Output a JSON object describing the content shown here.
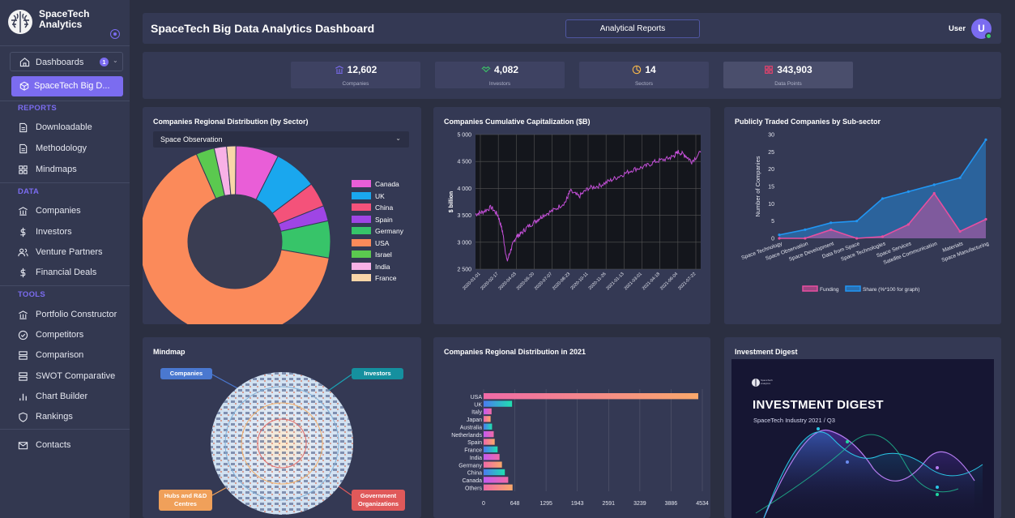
{
  "app": {
    "name": "SpaceTech Analytics"
  },
  "sidebar": {
    "dashboards_label": "Dashboards",
    "dashboards_badge": "1",
    "active_label": "SpaceTech Big D...",
    "reports_section": "REPORTS",
    "reports": [
      {
        "label": "Downloadable",
        "icon": "document-icon"
      },
      {
        "label": "Methodology",
        "icon": "document-icon"
      },
      {
        "label": "Mindmaps",
        "icon": "grid-icon"
      }
    ],
    "data_section": "DATA",
    "data_items": [
      {
        "label": "Companies",
        "icon": "building-icon"
      },
      {
        "label": "Investors",
        "icon": "dollar-icon"
      },
      {
        "label": "Venture Partners",
        "icon": "users-icon"
      },
      {
        "label": "Financial Deals",
        "icon": "dollar-icon"
      }
    ],
    "tools_section": "TOOLS",
    "tools": [
      {
        "label": "Portfolio Constructor",
        "icon": "building-icon"
      },
      {
        "label": "Competitors",
        "icon": "check-circle-icon"
      },
      {
        "label": "Comparison",
        "icon": "server-icon"
      },
      {
        "label": "SWOT Comparative",
        "icon": "server-icon"
      },
      {
        "label": "Chart Builder",
        "icon": "bar-chart-icon"
      },
      {
        "label": "Rankings",
        "icon": "shield-icon"
      }
    ],
    "contacts_label": "Contacts"
  },
  "header": {
    "title": "SpaceTech Big Data Analytics Dashboard",
    "reports_button": "Analytical Reports",
    "user_label": "User",
    "avatar_letter": "U"
  },
  "stats": [
    {
      "value": "12,602",
      "label": "Companies",
      "icon": "building-icon"
    },
    {
      "value": "4,082",
      "label": "Investors",
      "icon": "handshake-icon"
    },
    {
      "value": "14",
      "label": "Sectors",
      "icon": "pie-icon"
    },
    {
      "value": "343,903",
      "label": "Data Points",
      "icon": "grid-icon"
    }
  ],
  "panels": {
    "p1": {
      "title": "Companies Regional Distribution (by Sector)",
      "select_value": "Space Observation"
    },
    "p2": {
      "title": "Companies Cumulative Capitalization ($B)"
    },
    "p3": {
      "title": "Publicly Traded Companies by Sub-sector"
    },
    "p4": {
      "title": "Mindmap",
      "tags": [
        "Companies",
        "Investors",
        "Hubs and R&D Centres",
        "Government Organizations"
      ]
    },
    "p5": {
      "title": "Companies Regional Distribution in 2021"
    },
    "p6": {
      "title": "Investment Digest",
      "digest_title": "INVESTMENT DIGEST",
      "digest_sub": "SpaceTech Industry 2021 / Q3",
      "digest_logo": "SpaceTech Analytics"
    }
  },
  "colors": {
    "accent": "#7b6cf0",
    "panel": "#343954",
    "bg": "#2b2f41"
  },
  "chart_data": [
    {
      "type": "pie",
      "title": "Companies Regional Distribution (by Sector)",
      "categories": [
        "Canada",
        "UK",
        "China",
        "Spain",
        "Germany",
        "USA",
        "Israel",
        "India",
        "France"
      ],
      "values": [
        7,
        7,
        4,
        2.5,
        6,
        63,
        3,
        2,
        1.5
      ],
      "colors": [
        "#e95ed7",
        "#1aa7ee",
        "#f4527a",
        "#9f45e5",
        "#37c469",
        "#fb8a5a",
        "#5bc94f",
        "#f8b1e6",
        "#f9d6a8"
      ],
      "legend": "right"
    },
    {
      "type": "line",
      "title": "Companies Cumulative Capitalization ($B)",
      "ylabel": "$ billion",
      "ylim": [
        2500,
        5000
      ],
      "yticks": [
        "2 500",
        "3 000",
        "3 500",
        "4 000",
        "4 500",
        "5 000"
      ],
      "xticks": [
        "2020-01-01",
        "2020-02-17",
        "2020-04-03",
        "2020-05-20",
        "2020-07-07",
        "2020-08-23",
        "2020-10-11",
        "2020-11-26",
        "2021-01-13",
        "2021-03-01",
        "2021-04-18",
        "2021-06-04",
        "2021-07-22"
      ],
      "x": [
        0,
        0.03,
        0.07,
        0.1,
        0.12,
        0.14,
        0.16,
        0.18,
        0.2,
        0.23,
        0.27,
        0.3,
        0.35,
        0.4,
        0.42,
        0.46,
        0.5,
        0.55,
        0.6,
        0.65,
        0.7,
        0.75,
        0.8,
        0.85,
        0.88,
        0.9,
        0.93,
        0.96,
        1
      ],
      "values": [
        3520,
        3560,
        3650,
        3500,
        3200,
        2640,
        2900,
        3100,
        3150,
        3280,
        3400,
        3500,
        3600,
        3750,
        3950,
        3850,
        4000,
        4050,
        4150,
        4250,
        4350,
        4400,
        4500,
        4550,
        4600,
        4680,
        4620,
        4500,
        4670
      ]
    },
    {
      "type": "area",
      "title": "Publicly Traded Companies by Sub-sector",
      "ylabel": "Number of Companies",
      "ylim": [
        0,
        30
      ],
      "yticks": [
        "0",
        "5",
        "10",
        "15",
        "20",
        "25",
        "30"
      ],
      "categories": [
        "Space Technology",
        "Space Observation",
        "Space Development",
        "Data from Space",
        "Space Technologies",
        "Space Services",
        "Satellite Communication",
        "Materials",
        "Space Manufacturing"
      ],
      "series": [
        {
          "name": "Funding",
          "values": [
            0,
            0,
            2.5,
            0,
            0.5,
            4,
            13,
            2,
            5.5
          ],
          "color": "#e64fa0"
        },
        {
          "name": "Share (%*100 for graph)",
          "values": [
            1,
            2.5,
            4.5,
            5,
            11.5,
            13.5,
            15.5,
            17.5,
            28.5
          ],
          "color": "#2196f3"
        }
      ]
    },
    {
      "type": "bar",
      "title": "Companies Regional Distribution in 2021",
      "orientation": "horizontal",
      "categories": [
        "USA",
        "UK",
        "Italy",
        "Japan",
        "Australia",
        "Netherlands",
        "Spain",
        "France",
        "India",
        "Germany",
        "China",
        "Canada",
        "Others"
      ],
      "values": [
        4450,
        590,
        165,
        145,
        175,
        210,
        230,
        290,
        330,
        380,
        440,
        510,
        600
      ],
      "xticks": [
        "0",
        "648",
        "1295",
        "1943",
        "2591",
        "3239",
        "3886",
        "4534"
      ],
      "xlim": [
        0,
        4534
      ]
    }
  ]
}
